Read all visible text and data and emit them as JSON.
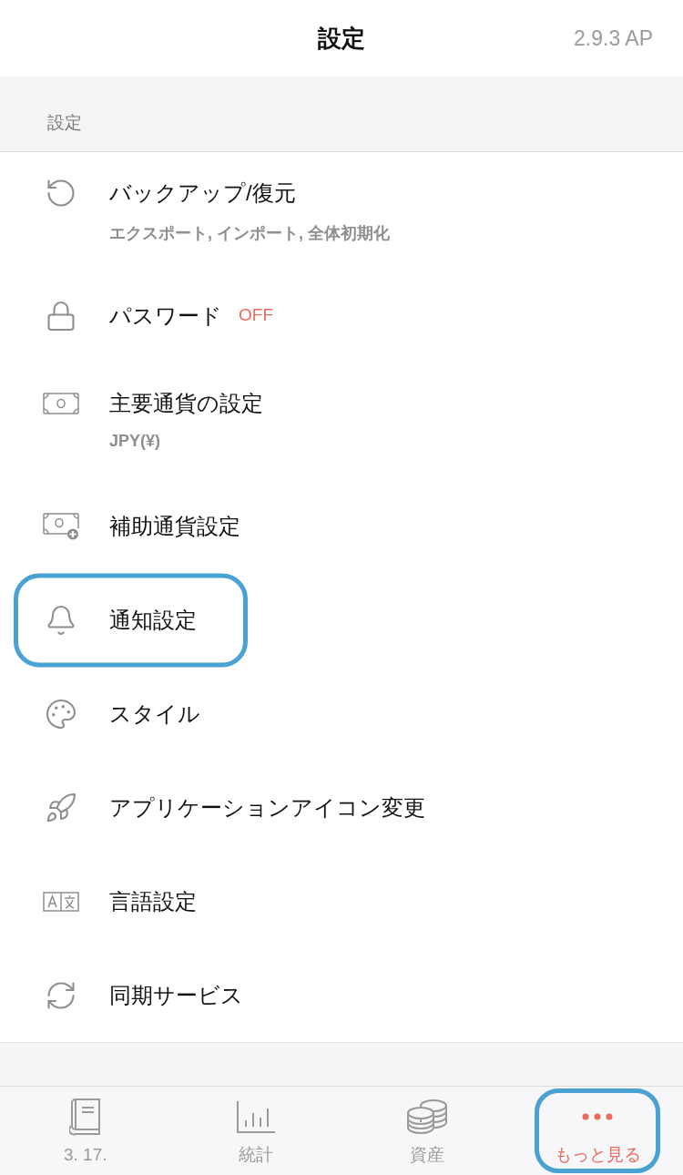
{
  "header": {
    "title": "設定",
    "version": "2.9.3 AP"
  },
  "section": {
    "label": "設定"
  },
  "items": [
    {
      "kind": "backup",
      "title": "バックアップ/復元",
      "subtitle": "エクスポート, インポート, 全体初期化",
      "highlighted": false
    },
    {
      "kind": "lock",
      "title": "パスワード",
      "status": "OFF",
      "highlighted": false
    },
    {
      "kind": "banknote",
      "title": "主要通貨の設定",
      "subtitle": "JPY(¥)",
      "highlighted": false
    },
    {
      "kind": "banknote_plus",
      "title": "補助通貨設定",
      "highlighted": false
    },
    {
      "kind": "bell",
      "title": "通知設定",
      "highlighted": true
    },
    {
      "kind": "palette",
      "title": "スタイル",
      "highlighted": false
    },
    {
      "kind": "rocket",
      "title": "アプリケーションアイコン変更",
      "highlighted": false
    },
    {
      "kind": "translate",
      "title": "言語設定",
      "highlighted": false
    },
    {
      "kind": "sync",
      "title": "同期サービス",
      "highlighted": false
    }
  ],
  "tab_bar": {
    "tabs": [
      {
        "kind": "book",
        "label": "3. 17.",
        "selected": false,
        "highlighted": false
      },
      {
        "kind": "chart",
        "label": "統計",
        "selected": false,
        "highlighted": false
      },
      {
        "kind": "coins",
        "label": "資産",
        "selected": false,
        "highlighted": false
      },
      {
        "kind": "more",
        "label": "もっと見る",
        "selected": true,
        "highlighted": true
      }
    ]
  }
}
